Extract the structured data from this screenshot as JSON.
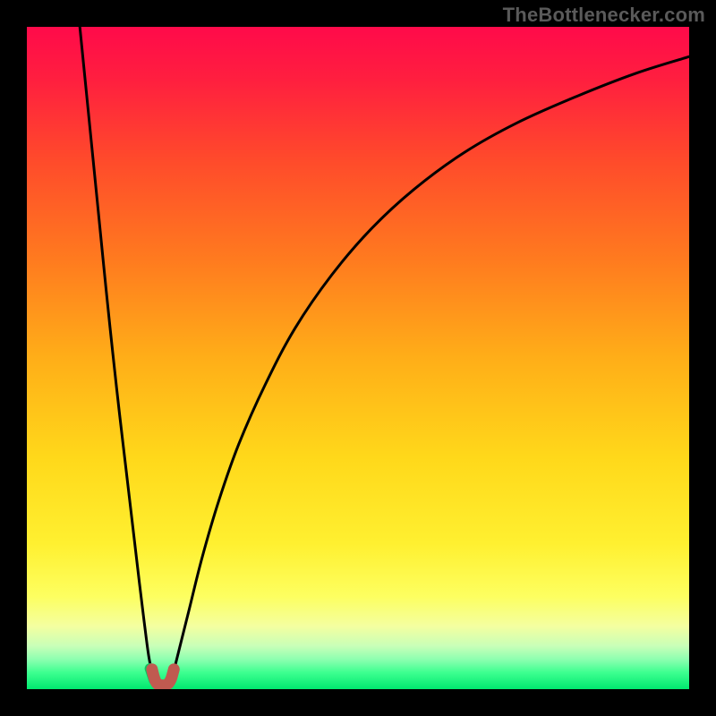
{
  "attribution": "TheBottlenecker.com",
  "colors": {
    "frame": "#000000",
    "curve": "#000000",
    "marker_red": "#c05a50",
    "marker_green": "#11c060",
    "gradient_stops": [
      {
        "offset": 0.0,
        "color": "#ff0a4a"
      },
      {
        "offset": 0.08,
        "color": "#ff1f3f"
      },
      {
        "offset": 0.2,
        "color": "#ff4a2b"
      },
      {
        "offset": 0.35,
        "color": "#ff7a1f"
      },
      {
        "offset": 0.5,
        "color": "#ffae18"
      },
      {
        "offset": 0.65,
        "color": "#ffd81a"
      },
      {
        "offset": 0.78,
        "color": "#fff030"
      },
      {
        "offset": 0.86,
        "color": "#fdff60"
      },
      {
        "offset": 0.905,
        "color": "#f4ffa0"
      },
      {
        "offset": 0.935,
        "color": "#c8ffb8"
      },
      {
        "offset": 0.955,
        "color": "#8dffb0"
      },
      {
        "offset": 0.975,
        "color": "#3dff90"
      },
      {
        "offset": 1.0,
        "color": "#00e86f"
      }
    ]
  },
  "chart_data": {
    "type": "line",
    "title": "",
    "xlabel": "",
    "ylabel": "",
    "xlim": [
      0,
      100
    ],
    "ylim": [
      0,
      100
    ],
    "grid": false,
    "series": [
      {
        "name": "left-branch",
        "x": [
          8.0,
          9.0,
          10.0,
          11.0,
          12.0,
          13.0,
          14.0,
          15.0,
          16.0,
          17.0,
          17.8,
          18.4,
          19.0
        ],
        "y": [
          100.0,
          90.0,
          80.0,
          70.0,
          60.0,
          50.5,
          41.5,
          33.0,
          24.5,
          16.0,
          9.5,
          5.0,
          2.0
        ]
      },
      {
        "name": "right-branch",
        "x": [
          22.0,
          23.0,
          24.5,
          26.5,
          29.0,
          32.0,
          36.0,
          40.5,
          46.0,
          52.0,
          58.5,
          66.0,
          74.0,
          83.0,
          92.0,
          100.0
        ],
        "y": [
          2.0,
          6.0,
          12.0,
          20.0,
          28.5,
          37.0,
          46.0,
          54.5,
          62.5,
          69.5,
          75.5,
          81.0,
          85.5,
          89.5,
          93.0,
          95.5
        ]
      },
      {
        "name": "marker-trough",
        "x": [
          18.9,
          19.3,
          19.7,
          20.3,
          20.9,
          21.4,
          21.8,
          22.2
        ],
        "y": [
          3.0,
          1.5,
          0.8,
          0.6,
          0.6,
          0.9,
          1.6,
          3.0
        ]
      }
    ],
    "annotations": []
  }
}
